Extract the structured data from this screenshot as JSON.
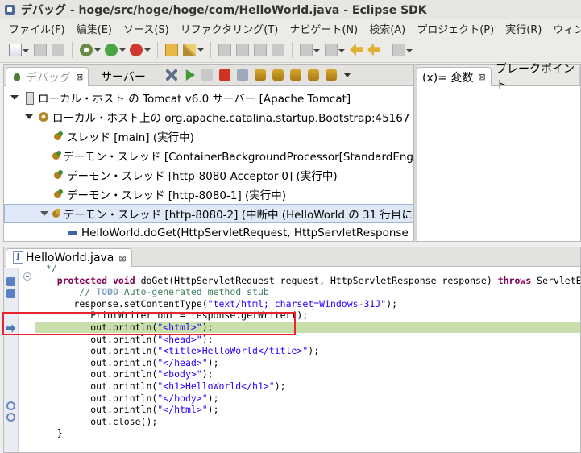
{
  "window": {
    "title": "デバッグ - hoge/src/hoge/hoge/com/HelloWorld.java - Eclipse SDK"
  },
  "menu": [
    "ファイル(F)",
    "編集(E)",
    "ソース(S)",
    "リファクタリング(T)",
    "ナビゲート(N)",
    "検索(A)",
    "プロジェクト(P)",
    "実行(R)",
    "ウィンドウ"
  ],
  "debug_view": {
    "tabs": [
      {
        "label": "デバッグ",
        "close": "⊠"
      },
      {
        "label": "サーバー"
      }
    ],
    "tree": [
      {
        "indent": 0,
        "icon": "server",
        "label": "ローカル・ホスト の Tomcat v6.0 サーバー [Apache Tomcat]",
        "twisty": true
      },
      {
        "indent": 1,
        "icon": "gearproc",
        "label": "ローカル・ホスト上の org.apache.catalina.startup.Bootstrap:45167",
        "twisty": true
      },
      {
        "indent": 2,
        "icon": "thread",
        "label": "スレッド [main] (実行中)",
        "twisty": false
      },
      {
        "indent": 2,
        "icon": "thread",
        "label": "デーモン・スレッド [ContainerBackgroundProcessor[StandardEng",
        "twisty": false
      },
      {
        "indent": 2,
        "icon": "thread",
        "label": "デーモン・スレッド [http-8080-Acceptor-0] (実行中)",
        "twisty": false
      },
      {
        "indent": 2,
        "icon": "thread",
        "label": "デーモン・スレッド [http-8080-1] (実行中)",
        "twisty": false
      },
      {
        "indent": 2,
        "icon": "thread-susp",
        "label": "デーモン・スレッド [http-8080-2] (中断中 (HelloWorld の 31 行目に",
        "twisty": true,
        "selected": true
      },
      {
        "indent": 3,
        "icon": "frame",
        "label": "HelloWorld.doGet(HttpServletRequest, HttpServletResponse",
        "twisty": false
      }
    ]
  },
  "vars_view": {
    "tabs": [
      {
        "label": "(x)= 変数",
        "close": "⊠"
      },
      {
        "label": "ブレークポイント"
      }
    ]
  },
  "editor": {
    "tab": {
      "label": "HelloWorld.java",
      "close": "⊠"
    },
    "lines": [
      {
        "text": "  */",
        "kind": "comment-tail"
      },
      {
        "parts": [
          [
            "    ",
            ""
          ],
          [
            "protected",
            "kw"
          ],
          [
            " ",
            ""
          ],
          [
            "void",
            "kw"
          ],
          [
            " doGet(HttpServletRequest request, HttpServletResponse response) ",
            ""
          ],
          [
            "throws",
            "kw"
          ],
          [
            " ServletExcep",
            ""
          ]
        ]
      },
      {
        "parts": [
          [
            "        ",
            ""
          ],
          [
            "// ",
            "cm"
          ],
          [
            "TODO",
            "todo"
          ],
          [
            " Auto-generated method stub",
            "cm"
          ]
        ]
      },
      {
        "parts": [
          [
            "       response.setContentType(",
            ""
          ],
          [
            "\"text/html; charset=Windows-31J\"",
            "str"
          ],
          [
            ");",
            ""
          ]
        ]
      },
      {
        "parts": [
          [
            "          PrintWriter out = response.getWriter();",
            ""
          ]
        ]
      },
      {
        "parts": [
          [
            "          out.println(",
            ""
          ],
          [
            "\"<html>\"",
            "str"
          ],
          [
            ");",
            ""
          ]
        ],
        "current": true
      },
      {
        "parts": [
          [
            "          out.println(",
            ""
          ],
          [
            "\"<head>\"",
            "str"
          ],
          [
            ");",
            ""
          ]
        ]
      },
      {
        "parts": [
          [
            "          out.println(",
            ""
          ],
          [
            "\"<title>HelloWorld</title>\"",
            "str"
          ],
          [
            ");",
            ""
          ]
        ]
      },
      {
        "parts": [
          [
            "          out.println(",
            ""
          ],
          [
            "\"</head>\"",
            "str"
          ],
          [
            ");",
            ""
          ]
        ]
      },
      {
        "parts": [
          [
            "          out.println(",
            ""
          ],
          [
            "\"<body>\"",
            "str"
          ],
          [
            ");",
            ""
          ]
        ]
      },
      {
        "parts": [
          [
            "          out.println(",
            ""
          ],
          [
            "\"<h1>HelloWorld</h1>\"",
            "str"
          ],
          [
            ");",
            ""
          ]
        ]
      },
      {
        "parts": [
          [
            "          out.println(",
            ""
          ],
          [
            "\"</body>\"",
            "str"
          ],
          [
            ");",
            ""
          ]
        ]
      },
      {
        "parts": [
          [
            "          out.println(",
            ""
          ],
          [
            "\"</html>\"",
            "str"
          ],
          [
            ");",
            ""
          ]
        ]
      },
      {
        "parts": [
          [
            "          out.close();",
            ""
          ]
        ]
      },
      {
        "parts": [
          [
            "    }",
            ""
          ]
        ]
      },
      {
        "parts": [
          [
            "",
            ""
          ]
        ]
      },
      {
        "parts": [
          [
            "    /**",
            "cm"
          ]
        ]
      }
    ]
  }
}
